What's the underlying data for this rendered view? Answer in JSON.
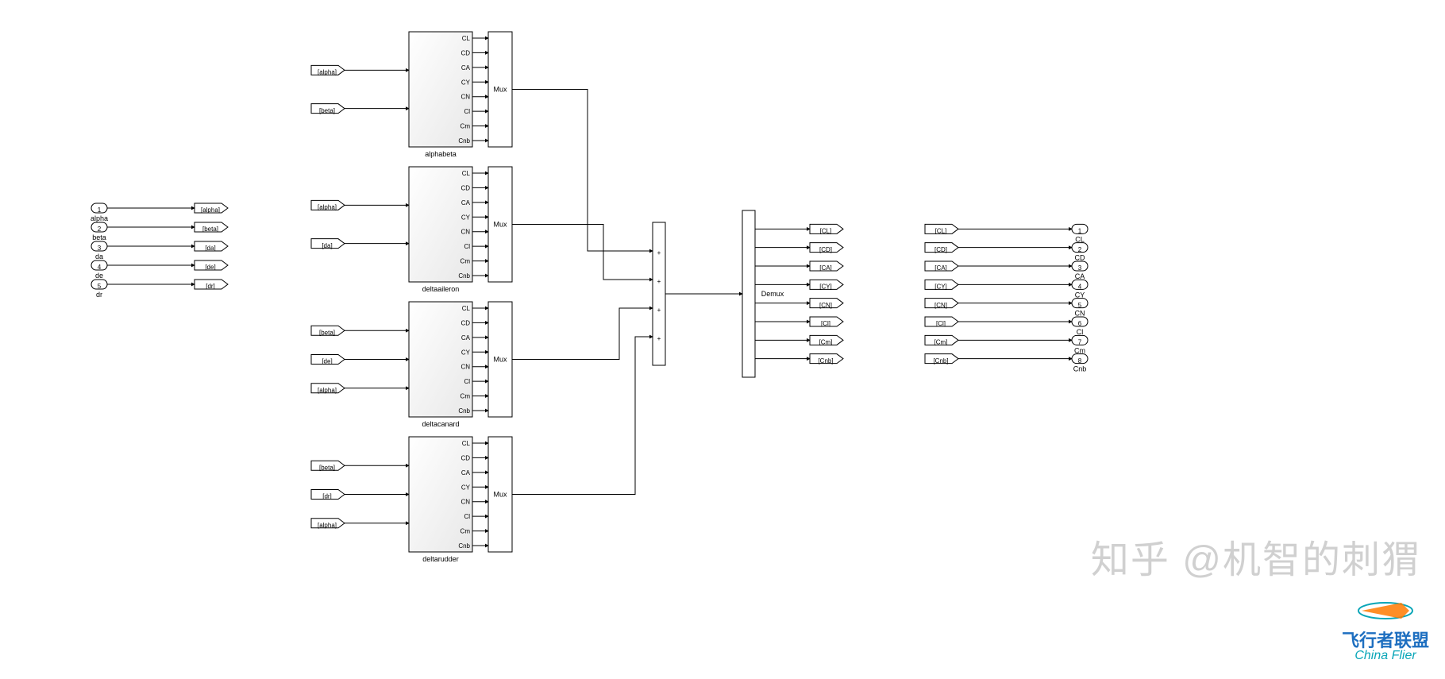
{
  "inports": [
    {
      "num": "1",
      "name": "alpha",
      "tag": "[alpha]"
    },
    {
      "num": "2",
      "name": "beta",
      "tag": "[beta]"
    },
    {
      "num": "3",
      "name": "da",
      "tag": "[da]"
    },
    {
      "num": "4",
      "name": "de",
      "tag": "[de]"
    },
    {
      "num": "5",
      "name": "dr",
      "tag": "[dr]"
    }
  ],
  "subsystems": [
    {
      "name": "alphabeta",
      "inputs": [
        {
          "label": "alpha",
          "tag": "[alpha]"
        },
        {
          "label": "beta",
          "tag": "[beta]"
        }
      ],
      "outputs": [
        "CL",
        "CD",
        "CA",
        "CY",
        "CN",
        "Cl",
        "Cm",
        "Cnb"
      ]
    },
    {
      "name": "deltaaileron",
      "inputs": [
        {
          "label": "alpha",
          "tag": "[alpha]"
        },
        {
          "label": "da",
          "tag": "[da]"
        }
      ],
      "outputs": [
        "CL",
        "CD",
        "CA",
        "CY",
        "CN",
        "Cl",
        "Cm",
        "Cnb"
      ]
    },
    {
      "name": "deltacanard",
      "inputs": [
        {
          "label": "beta",
          "tag": "[beta]"
        },
        {
          "label": "de",
          "tag": "[de]"
        },
        {
          "label": "alpha",
          "tag": "[alpha]"
        }
      ],
      "outputs": [
        "CL",
        "CD",
        "CA",
        "CY",
        "CN",
        "Cl",
        "Cm",
        "Cnb"
      ]
    },
    {
      "name": "deltarudder",
      "inputs": [
        {
          "label": "beta",
          "tag": "[beta]"
        },
        {
          "label": "dr",
          "tag": "[dr]"
        },
        {
          "label": "alpha",
          "tag": "[alpha]"
        }
      ],
      "outputs": [
        "CL",
        "CD",
        "CA",
        "CY",
        "CN",
        "Cl",
        "Cm",
        "Cnb"
      ]
    }
  ],
  "muxLabel": "Mux",
  "sumSigns": [
    "+",
    "+",
    "+",
    "+"
  ],
  "demuxLabel": "Demux",
  "demuxTags": [
    "[CL]",
    "[CD]",
    "[CA]",
    "[CY]",
    "[CN]",
    "[Cl]",
    "[Cm]",
    "[Cnb]"
  ],
  "outports": [
    {
      "tag": "[CL]",
      "num": "1",
      "name": "CL"
    },
    {
      "tag": "[CD]",
      "num": "2",
      "name": "CD"
    },
    {
      "tag": "[CA]",
      "num": "3",
      "name": "CA"
    },
    {
      "tag": "[CY]",
      "num": "4",
      "name": "CY"
    },
    {
      "tag": "[CN]",
      "num": "5",
      "name": "CN"
    },
    {
      "tag": "[Cl]",
      "num": "6",
      "name": "Cl"
    },
    {
      "tag": "[Cm]",
      "num": "7",
      "name": "Cm"
    },
    {
      "tag": "[Cnb]",
      "num": "8",
      "name": "Cnb"
    }
  ],
  "watermark": "知乎 @机智的刺猬",
  "logo": {
    "cn": "飞行者联盟",
    "en": "China Flier"
  }
}
